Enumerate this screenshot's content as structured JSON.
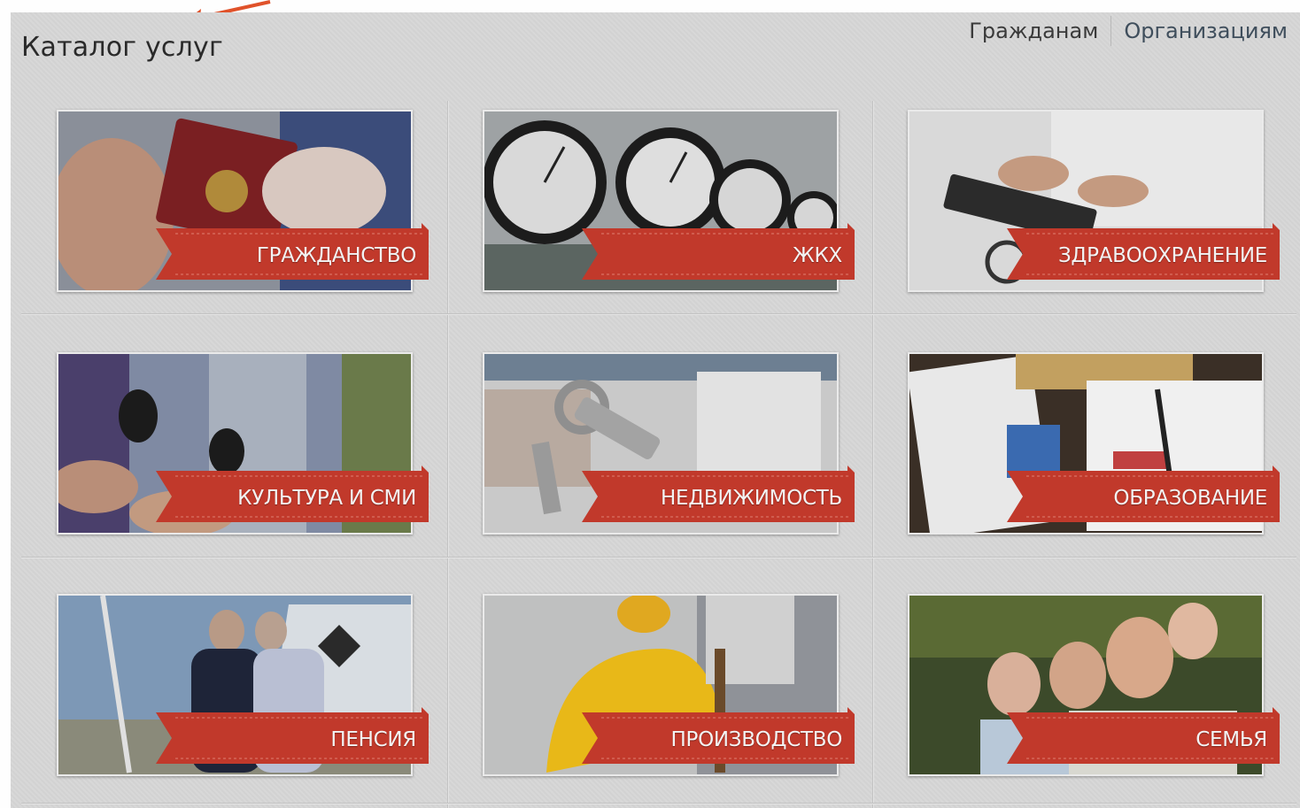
{
  "header": {
    "title": "Каталог услуг",
    "nav": [
      {
        "label": "Гражданам",
        "active": false
      },
      {
        "label": "Организациям",
        "active": true
      }
    ]
  },
  "tiles": [
    {
      "label": "ГРАЖДАНСТВО",
      "icon": "passport-photo"
    },
    {
      "label": "ЖКХ",
      "icon": "pressure-gauges-photo"
    },
    {
      "label": "ЗДРАВООХРАНЕНИЕ",
      "icon": "keyboard-stethoscope-photo"
    },
    {
      "label": "КУЛЬТУРА И СМИ",
      "icon": "microphones-photo"
    },
    {
      "label": "НЕДВИЖИМОСТЬ",
      "icon": "house-keys-photo"
    },
    {
      "label": "ОБРАЗОВАНИЕ",
      "icon": "school-supplies-photo"
    },
    {
      "label": "ПЕНСИЯ",
      "icon": "elderly-couple-photo"
    },
    {
      "label": "ПРОИЗВОДСТВО",
      "icon": "hard-hat-photo"
    },
    {
      "label": "СЕМЬЯ",
      "icon": "family-photo"
    }
  ],
  "colors": {
    "ribbon": "#c1392b",
    "overlay": "#d6d6d6",
    "arrow": "#e0522a"
  }
}
